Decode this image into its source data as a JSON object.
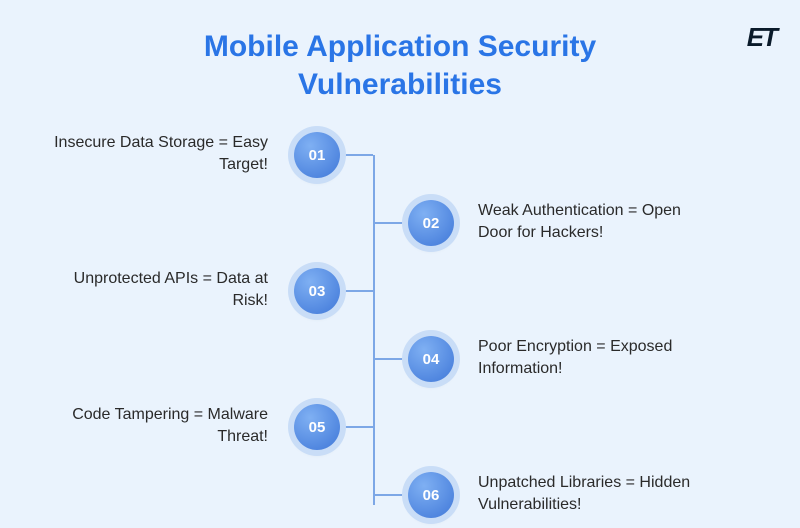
{
  "logo": "ET",
  "title": "Mobile Application Security Vulnerabilities",
  "items": [
    {
      "num": "01",
      "side": "left",
      "label": "Insecure Data Storage = Easy Target!"
    },
    {
      "num": "02",
      "side": "right",
      "label": "Weak Authentication = Open Door for Hackers!"
    },
    {
      "num": "03",
      "side": "left",
      "label": "Unprotected APIs = Data at Risk!"
    },
    {
      "num": "04",
      "side": "right",
      "label": "Poor Encryption = Exposed Information!"
    },
    {
      "num": "05",
      "side": "left",
      "label": "Code Tampering = Malware Threat!"
    },
    {
      "num": "06",
      "side": "right",
      "label": "Unpatched Libraries = Hidden Vulnerabilities!"
    }
  ],
  "colors": {
    "accent": "#2a75e6",
    "bg": "#eaf3fd"
  }
}
